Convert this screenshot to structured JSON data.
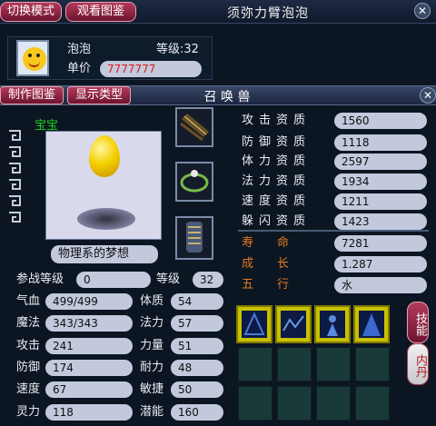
{
  "top": {
    "switch_mode": "切换模式",
    "view_guide": "观看图鉴",
    "window_title": "须弥力臂泡泡"
  },
  "info": {
    "name": "泡泡",
    "level_label": "等级:32",
    "price_label": "单价",
    "price_value": "7777777"
  },
  "second_bar": {
    "make_guide": "制作图鉴",
    "display_type": "显示类型",
    "title": "召 唤 兽"
  },
  "pet": {
    "tag": "宝宝",
    "name": "物理系的梦想"
  },
  "aptitudes": [
    {
      "label": "攻击资质",
      "value": "1560"
    },
    {
      "label": "防御资质",
      "value": "1118"
    },
    {
      "label": "体力资质",
      "value": "2597"
    },
    {
      "label": "法力资质",
      "value": "1934"
    },
    {
      "label": "速度资质",
      "value": "1211"
    },
    {
      "label": "躲闪资质",
      "value": "1423"
    }
  ],
  "extra": [
    {
      "label": "寿　　命",
      "value": "7281"
    },
    {
      "label": "成　　长",
      "value": "1.287"
    },
    {
      "label": "五　　行",
      "value": "水"
    }
  ],
  "battle": {
    "join_level_label": "参战等级",
    "join_level_value": "0",
    "level_label": "等级",
    "level_value": "32"
  },
  "stats_left": [
    {
      "label": "气血",
      "value": "499/499"
    },
    {
      "label": "魔法",
      "value": "343/343"
    },
    {
      "label": "攻击",
      "value": "241"
    },
    {
      "label": "防御",
      "value": "174"
    },
    {
      "label": "速度",
      "value": "67"
    },
    {
      "label": "灵力",
      "value": "118"
    }
  ],
  "stats_right": [
    {
      "label": "体质",
      "value": "54"
    },
    {
      "label": "法力",
      "value": "57"
    },
    {
      "label": "力量",
      "value": "51"
    },
    {
      "label": "耐力",
      "value": "48"
    },
    {
      "label": "敏捷",
      "value": "50"
    },
    {
      "label": "潜能",
      "value": "160"
    }
  ],
  "side_buttons": {
    "skills": "技能",
    "inner_dan": "内丹"
  },
  "colors": {
    "pet_tag": "#19d219",
    "price": "#e01818",
    "extra_label": "#e07820"
  }
}
